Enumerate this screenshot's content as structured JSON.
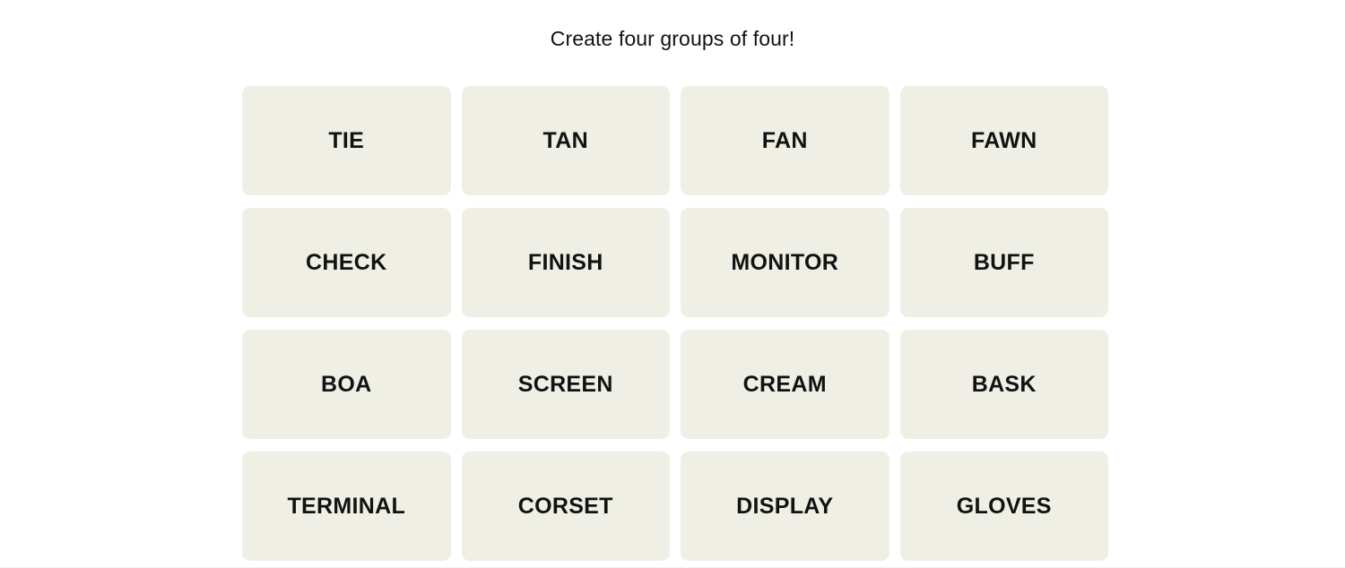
{
  "game": {
    "instruction": "Create four groups of four!",
    "colors": {
      "page_background": "#ffffff",
      "tile_background": "#efefe6",
      "text": "#121212"
    },
    "grid": {
      "rows": 4,
      "columns": 4
    },
    "tiles": [
      {
        "label": "TIE"
      },
      {
        "label": "TAN"
      },
      {
        "label": "FAN"
      },
      {
        "label": "FAWN"
      },
      {
        "label": "CHECK"
      },
      {
        "label": "FINISH"
      },
      {
        "label": "MONITOR"
      },
      {
        "label": "BUFF"
      },
      {
        "label": "BOA"
      },
      {
        "label": "SCREEN"
      },
      {
        "label": "CREAM"
      },
      {
        "label": "BASK"
      },
      {
        "label": "TERMINAL"
      },
      {
        "label": "CORSET"
      },
      {
        "label": "DISPLAY"
      },
      {
        "label": "GLOVES"
      }
    ]
  }
}
